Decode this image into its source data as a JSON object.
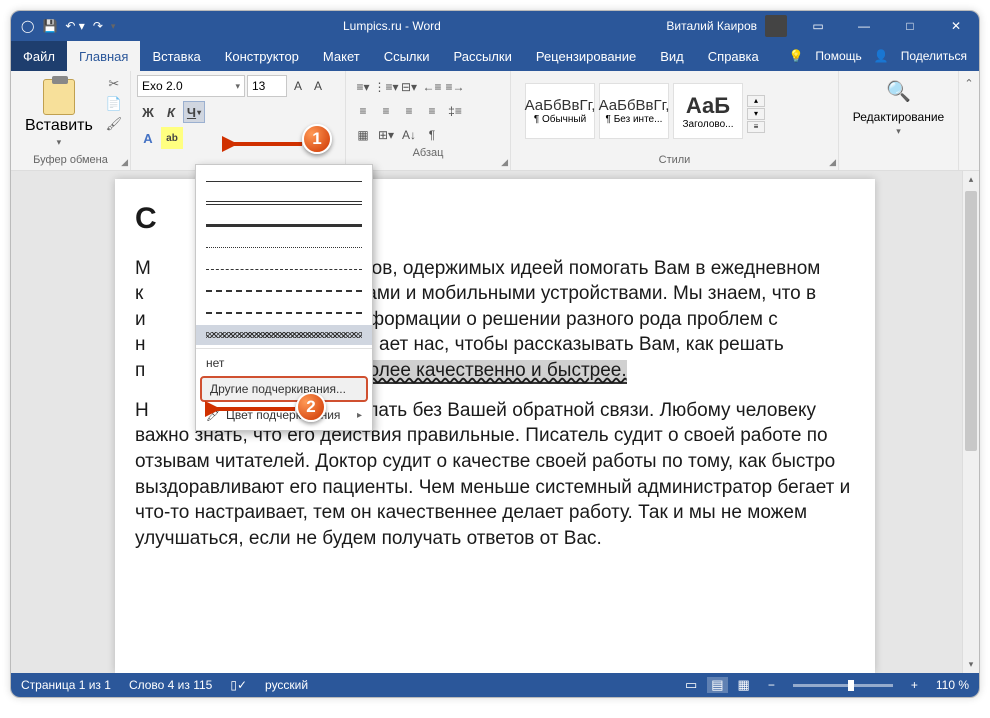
{
  "titlebar": {
    "title": "Lumpics.ru - Word",
    "user": "Виталий Каиров"
  },
  "tabs": {
    "file": "Файл",
    "home": "Главная",
    "insert": "Вставка",
    "design": "Конструктор",
    "layout": "Макет",
    "references": "Ссылки",
    "mailings": "Рассылки",
    "review": "Рецензирование",
    "view": "Вид",
    "help": "Справка",
    "tell_me": "Помощь",
    "share": "Поделиться"
  },
  "ribbon": {
    "clipboard": {
      "paste": "Вставить",
      "group": "Буфер обмена"
    },
    "font": {
      "name": "Exo 2.0",
      "size": "13",
      "bold": "Ж",
      "italic": "К",
      "underline": "Ч",
      "text_effects": "A",
      "highlight": "ab"
    },
    "paragraph": {
      "group": "Абзац"
    },
    "styles": {
      "group": "Стили",
      "items": [
        {
          "preview": "АаБбВвГг,",
          "name": "¶ Обычный"
        },
        {
          "preview": "АаБбВвГг,",
          "name": "¶ Без инте..."
        },
        {
          "preview": "АаБ",
          "name": "Заголово..."
        }
      ]
    },
    "editing": {
      "label": "Редактирование"
    }
  },
  "dropdown": {
    "none": "нет",
    "more": "Другие подчеркивания...",
    "color": "Цвет подчеркивания"
  },
  "document": {
    "heading_stub": "С",
    "p1_prefix": "М",
    "p1_a": "тов, одержимых идеей помогать Вам в ежедневном",
    "p1_b": "к",
    "p1_c": "ами и мобильными устройствами. Мы знаем, что в",
    "p1_d": "и",
    "p1_e": "нформации о решении разного рода проблем с",
    "p1_f": "н",
    "p1_g": "ает нас, чтобы рассказывать Вам, как решать",
    "p1_h": "п",
    "p1_i": "более качественно и быстрее.",
    "p2_a": "Н",
    "p2_b": "делать без Вашей обратной связи. Любому человеку важно знать, что его действия правильные. Писатель судит о своей работе по отзывам читателей. Доктор судит о качестве своей работы по тому, как быстро выздоравливают его пациенты. Чем меньше системный администратор бегает и что-то настраивает, тем он качественнее делает работу. Так и мы не можем улучшаться, если не будем получать ответов от Вас."
  },
  "statusbar": {
    "page": "Страница 1 из 1",
    "words": "Слово 4 из 115",
    "lang": "русский",
    "zoom": "110 %"
  },
  "badges": {
    "one": "1",
    "two": "2"
  }
}
